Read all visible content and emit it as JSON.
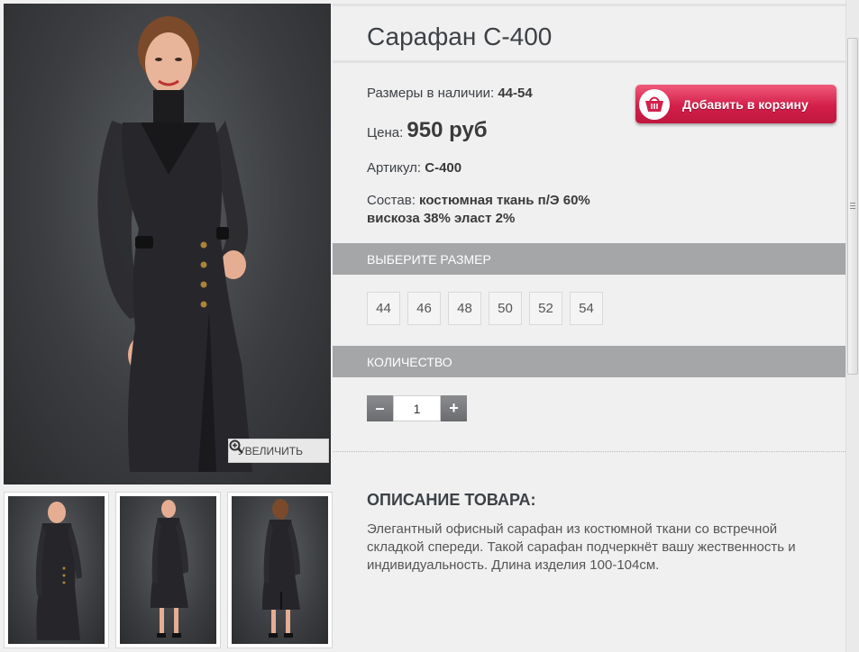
{
  "product": {
    "title": "Сарафан С-400",
    "sizes_available_label": "Размеры в наличии:",
    "sizes_available_value": "44-54",
    "price_label": "Цена:",
    "price_value": "950 руб",
    "article_label": "Артикул:",
    "article_value": "С-400",
    "composition_label": "Состав:",
    "composition_value_line1": "костюмная ткань п/Э 60%",
    "composition_value_line2": "вискоза 38% эласт 2%"
  },
  "cart_button": {
    "label": "Добавить в корзину",
    "icon": "basket-icon",
    "color": "#d31f4b"
  },
  "gallery": {
    "zoom_label": "УВЕЛИЧИТЬ",
    "zoom_icon": "magnifier-plus-icon",
    "thumbnails": [
      "front",
      "front-full",
      "back"
    ]
  },
  "size_section": {
    "header": "ВЫБЕРИТЕ РАЗМЕР",
    "options": [
      "44",
      "46",
      "48",
      "50",
      "52",
      "54"
    ]
  },
  "quantity_section": {
    "header": "КОЛИЧЕСТВО",
    "minus": "–",
    "plus": "+",
    "value": "1"
  },
  "description": {
    "title": "ОПИСАНИЕ ТОВАРА:",
    "text": "Элегантный офисный сарафан из костюмной ткани со встречной складкой спереди. Такой сарафан подчеркнёт вашу жественность и индивидуальность. Длина изделия 100-104см."
  },
  "colors": {
    "section_bar": "#a4a6a8",
    "background": "#f0f0f0"
  }
}
